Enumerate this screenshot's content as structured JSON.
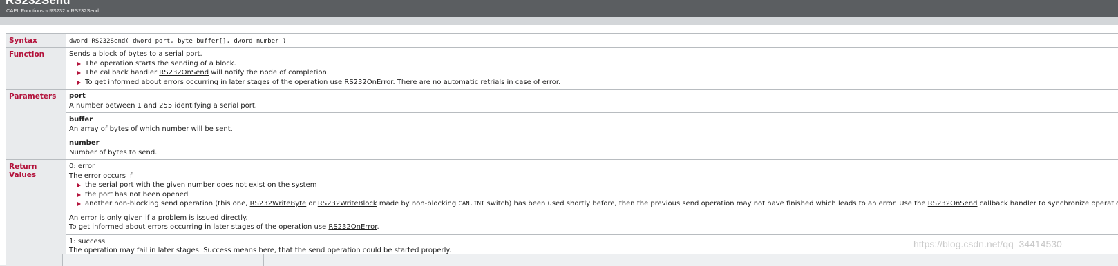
{
  "header": {
    "title": "RS232Send",
    "breadcrumb": "CAPL Functions » RS232 » RS232Send"
  },
  "labels": {
    "syntax": "Syntax",
    "function": "Function",
    "parameters": "Parameters",
    "return_values": "Return Values"
  },
  "syntax": "dword RS232Send( dword port, byte buffer[], dword number )",
  "function": {
    "intro": "Sends a block of bytes to a serial port.",
    "bullet1": "The operation starts the sending of a block.",
    "bullet2_pre": "The callback handler ",
    "bullet2_link": "RS232OnSend",
    "bullet2_post": " will notify the node of completion.",
    "bullet3_pre": "To get informed about errors occurring in later stages of the operation use ",
    "bullet3_link": "RS232OnError",
    "bullet3_post": ". There are no automatic retrials in case of error."
  },
  "parameters": [
    {
      "name": "port",
      "desc": "A number between 1 and 255 identifying a serial port."
    },
    {
      "name": "buffer",
      "desc": "An array of bytes of which number will be sent."
    },
    {
      "name": "number",
      "desc": "Number of bytes to send."
    }
  ],
  "return_values": {
    "error": {
      "code": "0: error",
      "occurs": "The error occurs if",
      "b1": "the serial port with the given number does not exist on the system",
      "b2": "the port has not been opened",
      "b3_a": "another non-blocking send operation (this one, ",
      "b3_link1": "RS232WriteByte",
      "b3_b": " or ",
      "b3_link2": "RS232WriteBlock",
      "b3_c": " made by non-blocking ",
      "b3_code": "CAN.INI",
      "b3_d": " switch) has been used shortly before, then the previous send operation may not have finished which leads to an error. Use the ",
      "b3_link3": "RS232OnSend",
      "b3_e": " callback handler to synchronize operations.",
      "note1": "An error is only given if a problem is issued directly.",
      "note2_pre": "To get informed about errors occurring in later stages of the operation use ",
      "note2_link": "RS232OnError",
      "note2_post": "."
    },
    "success": {
      "code": "1: success",
      "desc": "The operation may fail in later stages. Success means here, that the send operation could be started properly."
    }
  },
  "watermark": "https://blog.csdn.net/qq_34414530"
}
